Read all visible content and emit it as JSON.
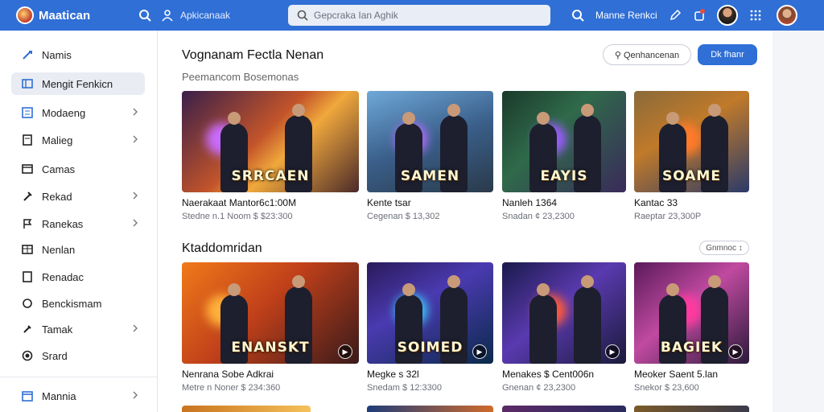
{
  "topbar": {
    "brand": "Maatican",
    "apps_link": "Apkicanaak",
    "search_placeholder": "Gepcraka Ian Aghik",
    "account_label": "Manne Renkci"
  },
  "sidebar": {
    "items": [
      {
        "label": "Namis",
        "icon": "sword-icon",
        "chev": false,
        "active": false
      },
      {
        "label": "Mengit Fenkicn",
        "icon": "grid-icon",
        "chev": false,
        "active": true
      },
      {
        "label": "Modaeng",
        "icon": "list-icon",
        "chev": true,
        "active": false
      },
      {
        "label": "Malieg",
        "icon": "document-icon",
        "chev": true,
        "active": false
      },
      {
        "label": "Camas",
        "icon": "window-icon",
        "chev": false,
        "active": false
      },
      {
        "label": "Rekad",
        "icon": "axe-icon",
        "chev": true,
        "active": false
      },
      {
        "label": "Ranekas",
        "icon": "flag-icon",
        "chev": true,
        "active": false
      },
      {
        "label": "Nenlan",
        "icon": "table-icon",
        "chev": false,
        "active": false
      },
      {
        "label": "Renadac",
        "icon": "page-icon",
        "chev": false,
        "active": false
      },
      {
        "label": "Benckismam",
        "icon": "circle-icon",
        "chev": false,
        "active": false
      },
      {
        "label": "Tamak",
        "icon": "tool-icon",
        "chev": true,
        "active": false
      },
      {
        "label": "Srard",
        "icon": "target-icon",
        "chev": false,
        "active": false
      }
    ],
    "footer": {
      "label": "Mannia",
      "icon": "calendar-icon"
    }
  },
  "section1": {
    "title": "Vognanam Fectla Nenan",
    "subtitle": "Peemancom Bosemonas",
    "outline_button": "Qenhancenan",
    "primary_button": "Dk fhanr",
    "cards": [
      {
        "title": "Naerakaat Mantor6c1:00M",
        "meta": "Stedne n.1 Noom $ $23:300",
        "logo": "SRRCAEN"
      },
      {
        "title": "Kente tsar",
        "meta": "Cegenan $ 13,302",
        "logo": "SAMEN"
      },
      {
        "title": "Nanleh 1364",
        "meta": "Snadan ¢ 23,2300",
        "logo": "EAYIS"
      },
      {
        "title": "Kantac 33",
        "meta": "Raeptar 23,300P",
        "logo": "SOAME"
      }
    ]
  },
  "section2": {
    "title": "Ktaddomridan",
    "chip": "Gnmnoc ↕",
    "cards": [
      {
        "title": "Nenrana Sobe Adkrai",
        "meta": "Metre n Noner $ 234:360",
        "logo": "ENANSKT"
      },
      {
        "title": "Megke s 32l",
        "meta": "Snedam $ 12:3300",
        "logo": "SOIMED"
      },
      {
        "title": "Menakes $ Cent006n",
        "meta": "Gnenan ¢ 23,2300",
        "logo": ""
      },
      {
        "title": "Meoker Saent 5.lan",
        "meta": "Snekor $ 23,600",
        "logo": "BAGIEK"
      }
    ]
  },
  "colors": {
    "accent": "#2f6fd6",
    "sidebar_active": "#e9ecf2"
  }
}
